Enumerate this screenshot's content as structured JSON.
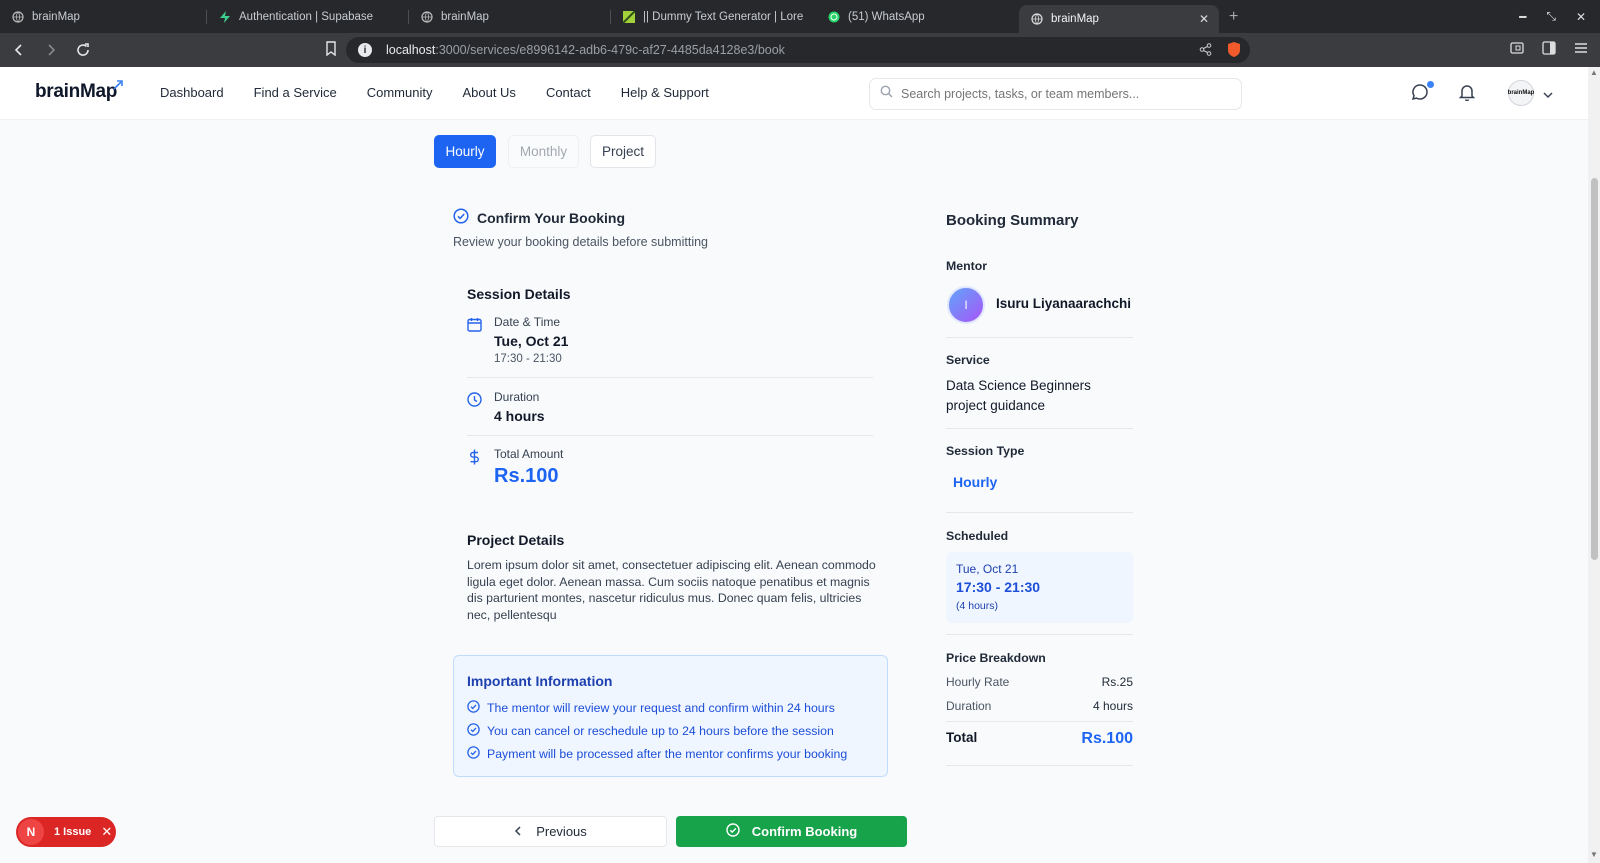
{
  "browser": {
    "tabs": [
      {
        "title": "brainMap",
        "active": false
      },
      {
        "title": "Authentication | Supabase",
        "active": false
      },
      {
        "title": "brainMap",
        "active": false
      },
      {
        "title": "|| Dummy Text Generator | Lore",
        "active": false
      },
      {
        "title": "(51) WhatsApp",
        "active": false
      },
      {
        "title": "brainMap",
        "active": true
      }
    ],
    "url_host": "localhost",
    "url_path": ":3000/services/e8996142-adb6-479c-af27-4485da4128e3/book"
  },
  "header": {
    "logo": "brainMap",
    "nav": [
      "Dashboard",
      "Find a Service",
      "Community",
      "About Us",
      "Contact",
      "Help & Support"
    ],
    "search_placeholder": "Search projects, tasks, or team members...",
    "avatar_text": "brainMap"
  },
  "session_types": {
    "hourly": "Hourly",
    "monthly": "Monthly",
    "project": "Project",
    "selected": "Hourly"
  },
  "confirm": {
    "title": "Confirm Your Booking",
    "subtitle": "Review your booking details before submitting",
    "session_details_title": "Session Details",
    "date_label": "Date & Time",
    "date_value": "Tue, Oct 21",
    "time_value": "17:30 - 21:30",
    "duration_label": "Duration",
    "duration_value": "4 hours",
    "amount_label": "Total Amount",
    "amount_value": "Rs.100",
    "project_title": "Project Details",
    "project_text": "Lorem ipsum dolor sit amet, consectetuer adipiscing elit. Aenean commodo ligula eget dolor. Aenean massa. Cum sociis natoque penatibus et magnis dis parturient montes, nascetur ridiculus mus. Donec quam felis, ultricies nec, pellentesqu"
  },
  "info": {
    "title": "Important Information",
    "items": [
      "The mentor will review your request and confirm within 24 hours",
      "You can cancel or reschedule up to 24 hours before the session",
      "Payment will be processed after the mentor confirms your booking"
    ]
  },
  "actions": {
    "previous": "Previous",
    "confirm": "Confirm Booking"
  },
  "summary": {
    "title": "Booking Summary",
    "mentor_label": "Mentor",
    "mentor_initial": "I",
    "mentor_name": "Isuru Liyanaarachchi",
    "service_label": "Service",
    "service_name": "Data Science Beginners project guidance",
    "session_type_label": "Session Type",
    "session_type": "Hourly",
    "scheduled_label": "Scheduled",
    "scheduled_date": "Tue, Oct 21",
    "scheduled_time": "17:30 - 21:30",
    "scheduled_duration": "(4 hours)",
    "price_label": "Price Breakdown",
    "hourly_rate_label": "Hourly Rate",
    "hourly_rate": "Rs.25",
    "duration_label": "Duration",
    "duration": "4 hours",
    "total_label": "Total",
    "total": "Rs.100"
  },
  "dev": {
    "badge": "N",
    "issues": "1 Issue"
  },
  "colors": {
    "primary": "#1d64f2",
    "confirm": "#16a34a",
    "issue": "#dc2626"
  }
}
